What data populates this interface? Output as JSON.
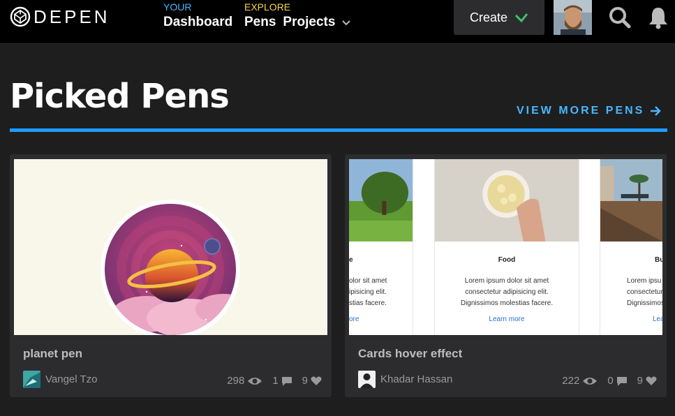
{
  "nav": {
    "logo_text": "DEPEN",
    "your_label": "YOUR",
    "dashboard_label": "Dashboard",
    "explore_label": "EXPLORE",
    "pens_label": "Pens",
    "projects_label": "Projects",
    "create_label": "Create"
  },
  "section": {
    "title": "Picked Pens",
    "view_more": "VIEW MORE PENS"
  },
  "cards": [
    {
      "title": "planet pen",
      "author": "Vangel Tzo",
      "views": "298",
      "comments": "1",
      "likes": "9"
    },
    {
      "title": "Cards hover effect",
      "author": "Khadar Hassan",
      "views": "222",
      "comments": "0",
      "likes": "9",
      "preview": {
        "left_title": "e",
        "left_body": [
          "olor sit amet",
          "ipisicing elit.",
          "stias facere."
        ],
        "left_link": "ore",
        "center_title": "Food",
        "center_body": [
          "Lorem ipsum dolor sit amet",
          "consectetur adipisicing elit.",
          "Dignissimos molestias facere."
        ],
        "center_link": "Learn more",
        "right_title": "Bu",
        "right_body": [
          "Lorem ipsu",
          "consectetur",
          "Dignissimos"
        ],
        "right_link": "Lea"
      }
    }
  ],
  "colors": {
    "accent_blue": "#47b8ff",
    "rule_blue": "#1e9bff",
    "explore_yellow": "#ffd54a",
    "create_check_green": "#3ec46d"
  }
}
